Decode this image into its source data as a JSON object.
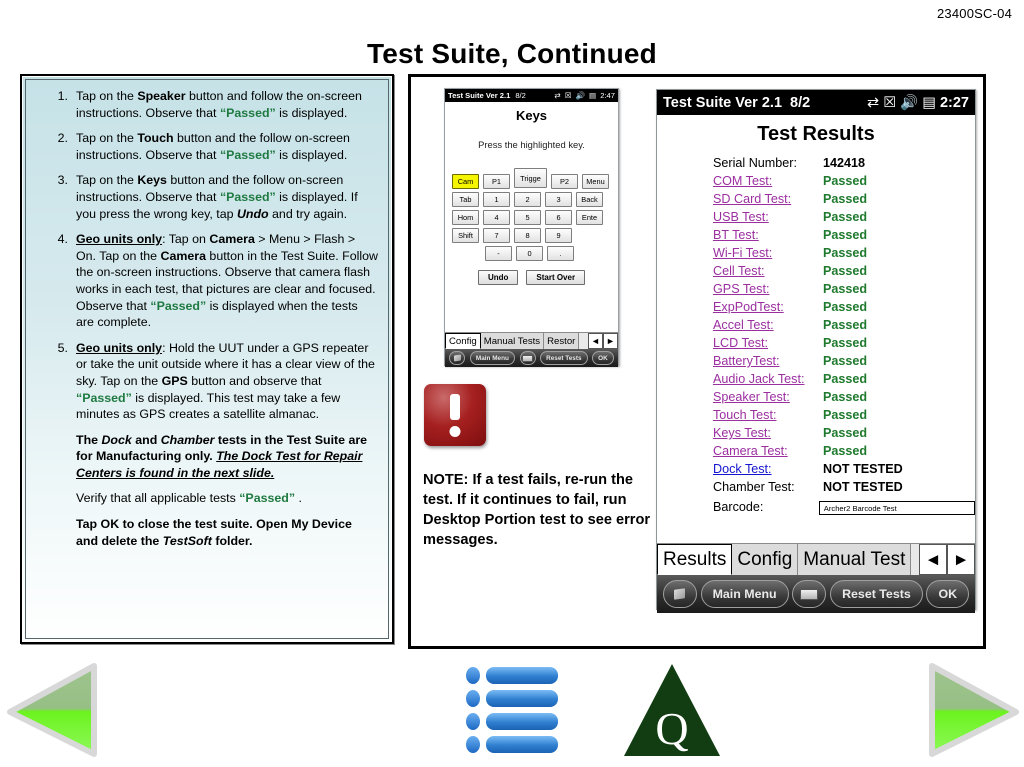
{
  "header": {
    "doc_code": "23400SC-04",
    "title": "Test Suite, Continued"
  },
  "instructions": {
    "steps": [
      {
        "number": "1.",
        "parts": [
          {
            "t": "Tap on the ",
            "s": "normal"
          },
          {
            "t": "Speaker",
            "s": "bold"
          },
          {
            "t": " button and follow the on-screen instructions. Observe that ",
            "s": "normal"
          },
          {
            "t": "“Passed”",
            "s": "pass"
          },
          {
            "t": " is displayed.",
            "s": "normal"
          }
        ]
      },
      {
        "number": "2.",
        "parts": [
          {
            "t": "Tap on the ",
            "s": "normal"
          },
          {
            "t": "Touch",
            "s": "bold"
          },
          {
            "t": " button and the follow on-screen instructions. Observe that ",
            "s": "normal"
          },
          {
            "t": "“Passed”",
            "s": "pass"
          },
          {
            "t": " is displayed.",
            "s": "normal"
          }
        ]
      },
      {
        "number": "3.",
        "parts": [
          {
            "t": "Tap on the ",
            "s": "normal"
          },
          {
            "t": "Keys",
            "s": "bold"
          },
          {
            "t": " button and the follow on-screen instructions. Observe that ",
            "s": "normal"
          },
          {
            "t": "“Passed”",
            "s": "pass"
          },
          {
            "t": " is displayed. If you press the wrong key, tap ",
            "s": "normal"
          },
          {
            "t": "Undo",
            "s": "bolditalic"
          },
          {
            "t": " and try again.",
            "s": "normal"
          }
        ]
      },
      {
        "number": "4.",
        "parts": [
          {
            "t": "Geo units only",
            "s": "boldunderline"
          },
          {
            "t": ": Tap on ",
            "s": "normal"
          },
          {
            "t": "Camera",
            "s": "bold"
          },
          {
            "t": " > Menu > Flash > On. Tap on the ",
            "s": "normal"
          },
          {
            "t": "Camera",
            "s": "bold"
          },
          {
            "t": " button in the Test Suite. Follow the on-screen instructions. Observe that camera flash works in each test, that pictures are clear and focused. Observe that ",
            "s": "normal"
          },
          {
            "t": "“Passed”",
            "s": "pass"
          },
          {
            "t": " is displayed when the tests are complete.",
            "s": "normal"
          }
        ]
      },
      {
        "number": "5.",
        "parts": [
          {
            "t": "Geo units only",
            "s": "boldunderline"
          },
          {
            "t": ": Hold the UUT under a  GPS repeater or take the unit outside where it has a clear view of the sky. Tap on the ",
            "s": "normal"
          },
          {
            "t": "GPS",
            "s": "bold"
          },
          {
            "t": " button and observe that ",
            "s": "normal"
          },
          {
            "t": "“Passed”",
            "s": "pass"
          },
          {
            "t": " is displayed. This test may take a few minutes as GPS creates a satellite almanac.",
            "s": "normal"
          }
        ]
      }
    ],
    "paragraphs": [
      {
        "bold": true,
        "parts": [
          {
            "t": "The ",
            "s": "bold"
          },
          {
            "t": "Dock",
            "s": "bolditalic"
          },
          {
            "t": " and ",
            "s": "bold"
          },
          {
            "t": "Chamber",
            "s": "bolditalic"
          },
          {
            "t": " tests in the Test Suite are for Manufacturing only. ",
            "s": "bold"
          },
          {
            "t": "The Dock Test for Repair Centers is found in the next slide.",
            "s": "bolditalicunderline"
          }
        ]
      },
      {
        "bold": false,
        "parts": [
          {
            "t": "Verify that all applicable tests ",
            "s": "normal"
          },
          {
            "t": "“Passed”",
            "s": "pass"
          },
          {
            "t": " .",
            "s": "normal"
          }
        ]
      },
      {
        "bold": true,
        "parts": [
          {
            "t": "Tap OK to close the test suite. Open My Device and delete the ",
            "s": "bold"
          },
          {
            "t": "TestSoft",
            "s": "bolditalic"
          },
          {
            "t": " folder.",
            "s": "bold"
          }
        ]
      }
    ]
  },
  "keys_device": {
    "titlebar": {
      "app": "Test Suite Ver 2.1",
      "date": "8/2",
      "time": "2:47",
      "icons": [
        "connectivity-icon",
        "signal-no-service-icon",
        "volume-icon",
        "battery-icon"
      ]
    },
    "heading": "Keys",
    "subheading": "Press the highlighted key.",
    "keypad_rows": [
      [
        {
          "label": "Cam",
          "hl": true
        },
        {
          "label": "P1"
        },
        {
          "label": "Trigge",
          "trig": true
        },
        {
          "label": "P2"
        },
        {
          "label": "Menu"
        }
      ],
      [
        {
          "label": "Tab"
        },
        {
          "label": "1"
        },
        {
          "label": "2"
        },
        {
          "label": "3"
        },
        {
          "label": "Back"
        }
      ],
      [
        {
          "label": "Hom"
        },
        {
          "label": "4"
        },
        {
          "label": "5"
        },
        {
          "label": "6"
        },
        {
          "label": "Ente"
        }
      ],
      [
        {
          "label": "Shift"
        },
        {
          "label": "7"
        },
        {
          "label": "8"
        },
        {
          "label": "9"
        }
      ],
      [
        {
          "label": "-"
        },
        {
          "label": "0"
        },
        {
          "label": "."
        }
      ]
    ],
    "actions": [
      "Undo",
      "Start Over"
    ],
    "tabs": [
      {
        "label": "Config",
        "selected": true
      },
      {
        "label": "Manual Tests",
        "selected": false
      },
      {
        "label": "Restor",
        "selected": false
      }
    ],
    "tab_nav": [
      "◄",
      "►"
    ],
    "commandbar": [
      "start-icon",
      "Main Menu",
      "keyboard-icon",
      "Reset Tests",
      "OK"
    ]
  },
  "results_device": {
    "titlebar": {
      "app": "Test Suite Ver 2.1",
      "date": "8/2",
      "time": "2:27",
      "icons": [
        "connectivity-icon",
        "signal-no-service-icon",
        "volume-icon",
        "battery-icon"
      ]
    },
    "heading": "Test Results",
    "rows": [
      {
        "label": "Serial Number:",
        "value": "142418",
        "label_style": "plain",
        "value_style": "dark"
      },
      {
        "label": "COM Test:",
        "value": "Passed",
        "label_style": "link",
        "value_style": "pass"
      },
      {
        "label": "SD Card Test:",
        "value": "Passed",
        "label_style": "link",
        "value_style": "pass"
      },
      {
        "label": "USB Test:",
        "value": "Passed",
        "label_style": "link",
        "value_style": "pass"
      },
      {
        "label": "BT Test:",
        "value": "Passed",
        "label_style": "link",
        "value_style": "pass"
      },
      {
        "label": "Wi-Fi Test:",
        "value": "Passed",
        "label_style": "link",
        "value_style": "pass"
      },
      {
        "label": "Cell Test:",
        "value": "Passed",
        "label_style": "link",
        "value_style": "pass"
      },
      {
        "label": "GPS Test:",
        "value": "Passed",
        "label_style": "link",
        "value_style": "pass"
      },
      {
        "label": "ExpPodTest:",
        "value": "Passed",
        "label_style": "link",
        "value_style": "pass"
      },
      {
        "label": "Accel Test:",
        "value": "Passed",
        "label_style": "link",
        "value_style": "pass"
      },
      {
        "label": "LCD Test:",
        "value": "Passed",
        "label_style": "link",
        "value_style": "pass"
      },
      {
        "label": "BatteryTest:",
        "value": "Passed",
        "label_style": "link",
        "value_style": "pass"
      },
      {
        "label": "Audio Jack Test:",
        "value": "Passed",
        "label_style": "link",
        "value_style": "pass"
      },
      {
        "label": "Speaker Test:",
        "value": "Passed",
        "label_style": "link",
        "value_style": "pass"
      },
      {
        "label": "Touch Test:",
        "value": "Passed",
        "label_style": "link",
        "value_style": "pass"
      },
      {
        "label": "Keys Test:",
        "value": "Passed",
        "label_style": "link",
        "value_style": "pass"
      },
      {
        "label": "Camera Test:",
        "value": "Passed",
        "label_style": "link",
        "value_style": "pass"
      },
      {
        "label": "Dock Test:",
        "value": "NOT TESTED",
        "label_style": "link-blue",
        "value_style": "dark"
      },
      {
        "label": "Chamber Test:",
        "value": "NOT TESTED",
        "label_style": "plain",
        "value_style": "dark"
      }
    ],
    "barcode": {
      "label": "Barcode:",
      "value": "Archer2 Barcode Test"
    },
    "tabs": [
      {
        "label": "Results",
        "selected": true
      },
      {
        "label": "Config",
        "selected": false
      },
      {
        "label": "Manual Test",
        "selected": false
      }
    ],
    "tab_nav": [
      "◄",
      "►"
    ],
    "commandbar": [
      "start-icon",
      "Main Menu",
      "keyboard-icon",
      "Reset Tests",
      "OK"
    ]
  },
  "note": {
    "icon": "warning-exclamation-icon",
    "text": "NOTE: If a test fails, re-run the test. If it continues to fail, run Desktop Portion test to see error messages."
  },
  "footer_nav": {
    "prev": "previous-slide-arrow",
    "next": "next-slide-arrow",
    "list_icon": "bulleted-list-icon",
    "logo": "q-triangle-logo",
    "logo_letter": "Q"
  },
  "colors": {
    "pass_green": "#1f7a41",
    "link_purple": "#9b2fa0",
    "link_blue": "#1414cf",
    "panel_bg": "#c6e2e7",
    "arrow_green": "#66ee22",
    "logo_green": "#123d12",
    "list_blue": "#2f7fd0"
  }
}
